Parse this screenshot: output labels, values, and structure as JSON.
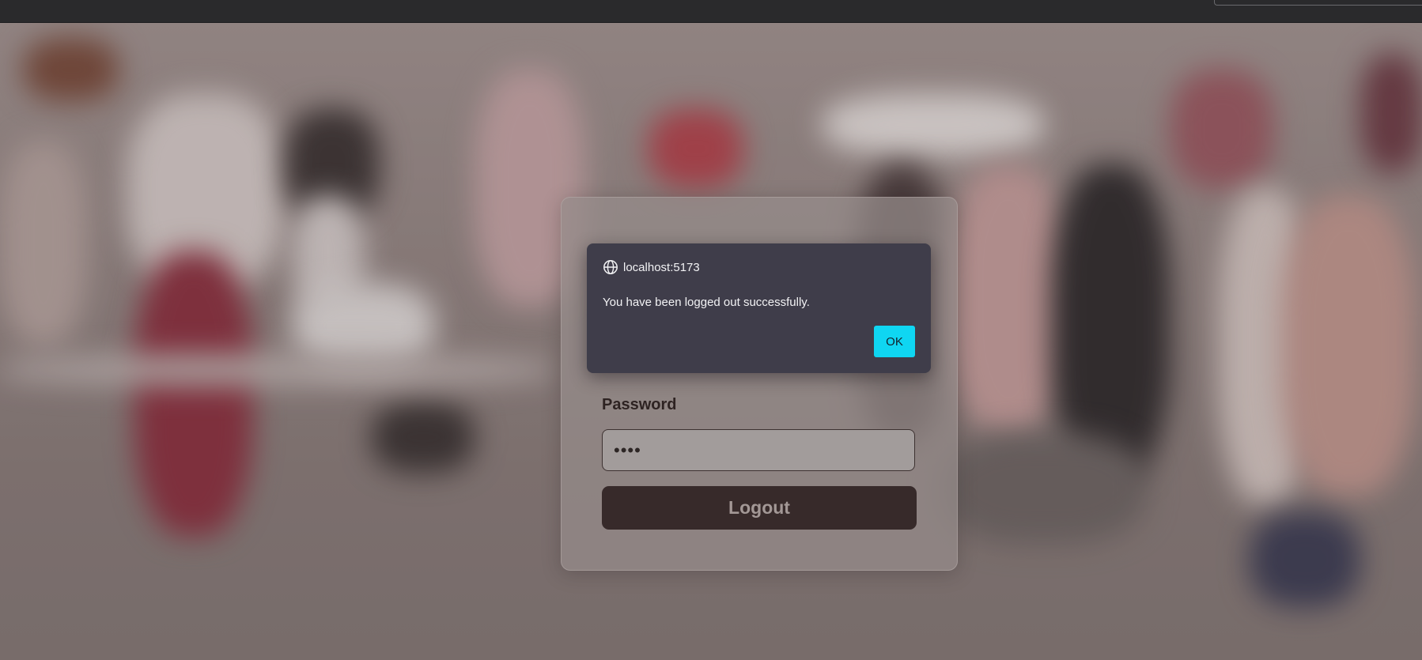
{
  "dialog": {
    "origin": "localhost:5173",
    "message": "You have been logged out successfully.",
    "ok_label": "OK",
    "origin_icon": "globe-icon"
  },
  "form": {
    "password_label": "Password",
    "password_value": "••••",
    "logout_label": "Logout"
  },
  "colors": {
    "dialog_bg": "#3f3d4a",
    "ok_button": "#0fd6f2",
    "logout_button": "#372a2a"
  }
}
